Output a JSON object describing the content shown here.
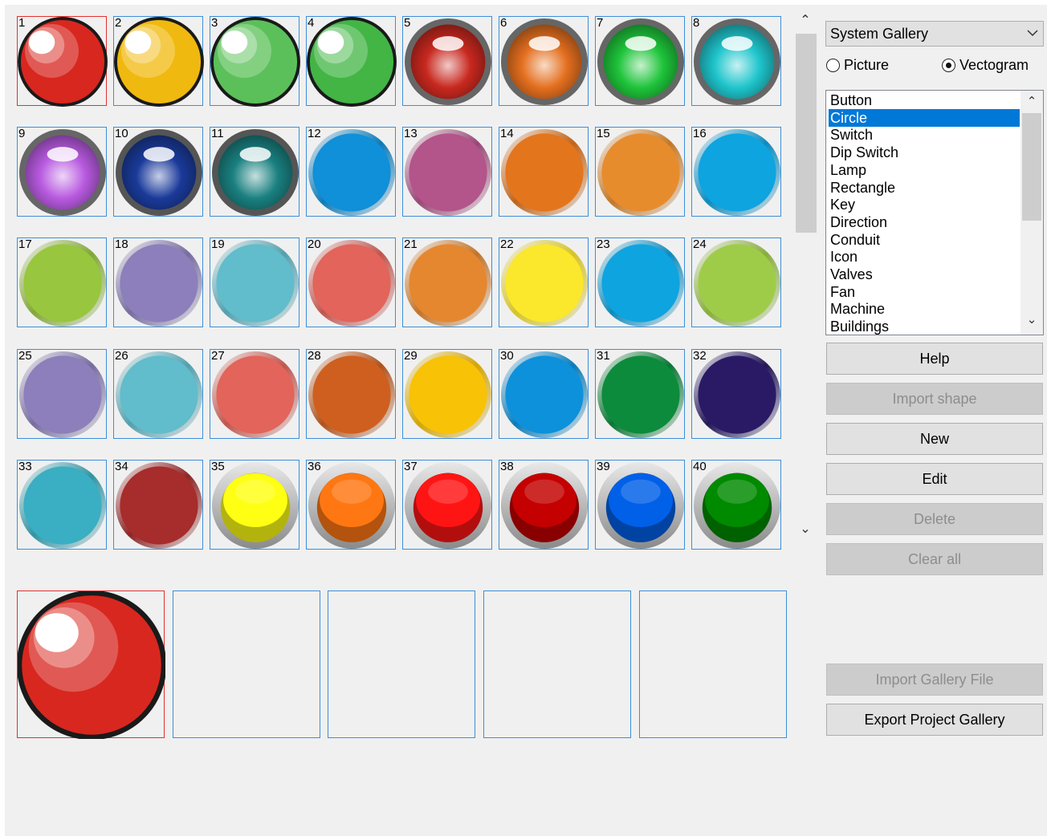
{
  "gallery": {
    "items": [
      {
        "num": "1",
        "style": "glossy",
        "color": "#d8271f",
        "ring": "#1a1a1a"
      },
      {
        "num": "2",
        "style": "glossy",
        "color": "#f0b90f",
        "ring": "#1a1a1a"
      },
      {
        "num": "3",
        "style": "glossy",
        "color": "#5cc05a",
        "ring": "#1a1a1a"
      },
      {
        "num": "4",
        "style": "glossy",
        "color": "#42b545",
        "ring": "#1a1a1a"
      },
      {
        "num": "5",
        "style": "gem",
        "color": "#c8281f",
        "ring": "#666666"
      },
      {
        "num": "6",
        "style": "gem",
        "color": "#e46f1f",
        "ring": "#666666"
      },
      {
        "num": "7",
        "style": "gem",
        "color": "#1ec43a",
        "ring": "#666666"
      },
      {
        "num": "8",
        "style": "gem",
        "color": "#1fc5cc",
        "ring": "#666666"
      },
      {
        "num": "9",
        "style": "gem",
        "color": "#b85ae0",
        "ring": "#666666"
      },
      {
        "num": "10",
        "style": "gem",
        "color": "#1a3a9a",
        "ring": "#555555"
      },
      {
        "num": "11",
        "style": "gem",
        "color": "#1a8080",
        "ring": "#555555"
      },
      {
        "num": "12",
        "style": "flat",
        "color": "#0f90d8",
        "ring": "#c7c7c7"
      },
      {
        "num": "13",
        "style": "flat",
        "color": "#b3548a",
        "ring": "#c7c7c7"
      },
      {
        "num": "14",
        "style": "flat",
        "color": "#e3751d",
        "ring": "#c7c7c7"
      },
      {
        "num": "15",
        "style": "flat",
        "color": "#e78c2d",
        "ring": "#c7c7c7"
      },
      {
        "num": "16",
        "style": "flat",
        "color": "#0da4e0",
        "ring": "#c7c7c7"
      },
      {
        "num": "17",
        "style": "flat",
        "color": "#98c63e",
        "ring": "#c7c7c7"
      },
      {
        "num": "18",
        "style": "flat",
        "color": "#8c7fbb",
        "ring": "#c7c7c7"
      },
      {
        "num": "19",
        "style": "flat",
        "color": "#61bccb",
        "ring": "#c7c7c7"
      },
      {
        "num": "20",
        "style": "flat",
        "color": "#e2645b",
        "ring": "#c7c7c7"
      },
      {
        "num": "21",
        "style": "flat",
        "color": "#e5872f",
        "ring": "#c7c7c7"
      },
      {
        "num": "22",
        "style": "flat",
        "color": "#fbe72b",
        "ring": "#c7c7c7"
      },
      {
        "num": "23",
        "style": "flat",
        "color": "#0ea4e0",
        "ring": "#c7c7c7"
      },
      {
        "num": "24",
        "style": "flat",
        "color": "#9fcc48",
        "ring": "#c7c7c7"
      },
      {
        "num": "25",
        "style": "flat",
        "color": "#8c7fbb",
        "ring": "#c7c7c7"
      },
      {
        "num": "26",
        "style": "flat",
        "color": "#61bccb",
        "ring": "#c7c7c7"
      },
      {
        "num": "27",
        "style": "flat",
        "color": "#e2645b",
        "ring": "#c7c7c7"
      },
      {
        "num": "28",
        "style": "flat",
        "color": "#cf5f1f",
        "ring": "#c7c7c7"
      },
      {
        "num": "29",
        "style": "flat",
        "color": "#f8c206",
        "ring": "#c7c7c7"
      },
      {
        "num": "30",
        "style": "flat",
        "color": "#0d91db",
        "ring": "#c7c7c7"
      },
      {
        "num": "31",
        "style": "flat",
        "color": "#0c8b3c",
        "ring": "#c7c7c7"
      },
      {
        "num": "32",
        "style": "flat",
        "color": "#2a1a66",
        "ring": "#c7c7c7"
      },
      {
        "num": "33",
        "style": "flat",
        "color": "#3aaec2",
        "ring": "#c7c7c7"
      },
      {
        "num": "34",
        "style": "flat",
        "color": "#a72c2c",
        "ring": "#c7c7c7"
      },
      {
        "num": "35",
        "style": "dome",
        "color": "#ffff14",
        "ring": "#9a9a9a"
      },
      {
        "num": "36",
        "style": "dome",
        "color": "#ff7712",
        "ring": "#9a9a9a"
      },
      {
        "num": "37",
        "style": "dome",
        "color": "#ff1414",
        "ring": "#9a9a9a"
      },
      {
        "num": "38",
        "style": "dome",
        "color": "#c40000",
        "ring": "#9a9a9a"
      },
      {
        "num": "39",
        "style": "dome",
        "color": "#0060e8",
        "ring": "#9a9a9a"
      },
      {
        "num": "40",
        "style": "dome",
        "color": "#008a00",
        "ring": "#9a9a9a"
      }
    ],
    "selected_index": 0
  },
  "preview": {
    "slots": 5,
    "selected_slot": 0,
    "selected_item": {
      "style": "glossy",
      "color": "#d8271f",
      "ring": "#1a1a1a"
    }
  },
  "right_panel": {
    "gallery_combo": "System Gallery",
    "radio_picture": "Picture",
    "radio_vectogram": "Vectogram",
    "selected_radio": "Vectogram",
    "categories": [
      "Button",
      "Circle",
      "Switch",
      "Dip Switch",
      "Lamp",
      "Rectangle",
      "Key",
      "Direction",
      "Conduit",
      "Icon",
      "Valves",
      "Fan",
      "Machine",
      "Buildings"
    ],
    "selected_category": "Circle",
    "buttons": {
      "help": "Help",
      "import_shape": "Import shape",
      "new": "New",
      "edit": "Edit",
      "delete": "Delete",
      "clear_all": "Clear all",
      "import_gallery_file": "Import Gallery File",
      "export_project_gallery": "Export Project Gallery"
    }
  },
  "icons": {
    "scroll_up": "chevron-up-icon",
    "scroll_down": "chevron-down-icon",
    "combo_chevron": "chevron-down-icon"
  }
}
